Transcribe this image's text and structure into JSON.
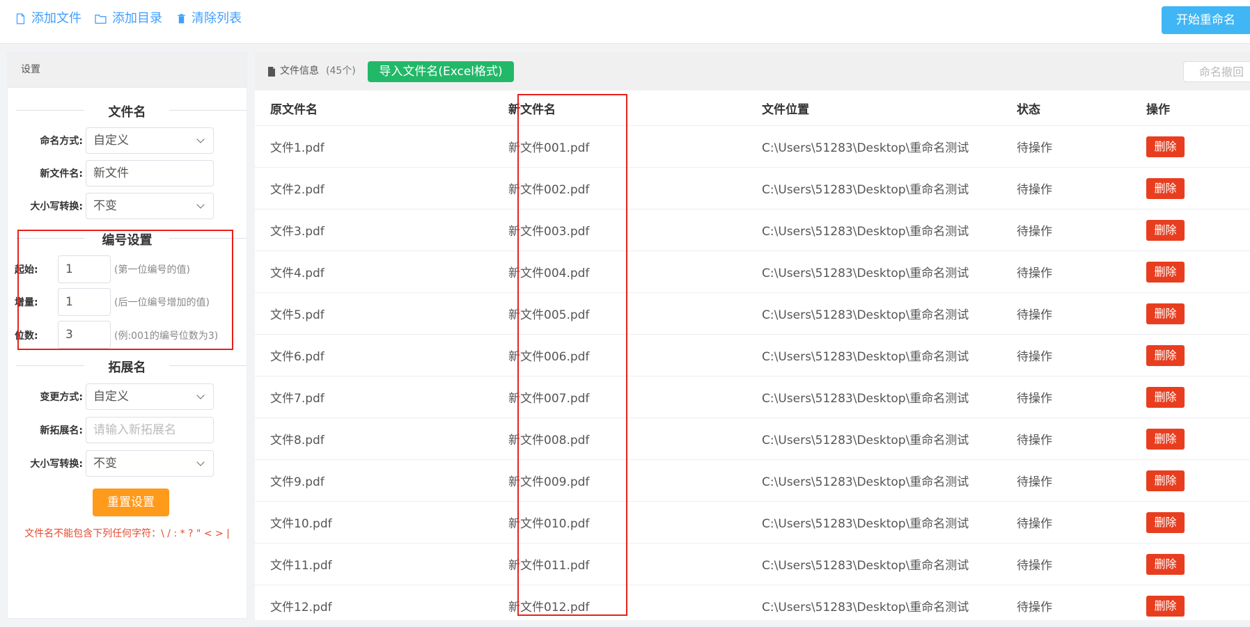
{
  "toolbar": {
    "add_file": "添加文件",
    "add_dir": "添加目录",
    "clear_list": "清除列表",
    "start_rename": "开始重命名"
  },
  "settings": {
    "header": "设置",
    "filename_section": "文件名",
    "naming_mode_label": "命名方式:",
    "naming_mode_value": "自定义",
    "new_name_label": "新文件名:",
    "new_name_value": "新文件",
    "case_label": "大小写转换:",
    "case_value": "不变",
    "numbering_section": "编号设置",
    "start_label": "起始:",
    "start_value": "1",
    "start_hint": "(第一位编号的值)",
    "step_label": "增量:",
    "step_value": "1",
    "step_hint": "(后一位编号增加的值)",
    "digits_label": "位数:",
    "digits_value": "3",
    "digits_hint": "(例:001的编号位数为3)",
    "ext_section": "拓展名",
    "ext_mode_label": "变更方式:",
    "ext_mode_value": "自定义",
    "new_ext_label": "新拓展名:",
    "new_ext_placeholder": "请输入新拓展名",
    "ext_case_label": "大小写转换:",
    "ext_case_value": "不变",
    "reset_button": "重置设置",
    "warning": "文件名不能包含下列任何字符：\\ / : * ? \" < > |"
  },
  "file_panel": {
    "info_label": "文件信息",
    "count": "(45个)",
    "import_button": "导入文件名(Excel格式)",
    "undo_button": "命名撤回",
    "columns": [
      "原文件名",
      "新文件名",
      "文件位置",
      "状态",
      "操作"
    ],
    "delete_label": "删除",
    "rows": [
      {
        "orig": "文件1.pdf",
        "new": "新文件001.pdf",
        "path": "C:\\Users\\51283\\Desktop\\重命名测试",
        "status": "待操作"
      },
      {
        "orig": "文件2.pdf",
        "new": "新文件002.pdf",
        "path": "C:\\Users\\51283\\Desktop\\重命名测试",
        "status": "待操作"
      },
      {
        "orig": "文件3.pdf",
        "new": "新文件003.pdf",
        "path": "C:\\Users\\51283\\Desktop\\重命名测试",
        "status": "待操作"
      },
      {
        "orig": "文件4.pdf",
        "new": "新文件004.pdf",
        "path": "C:\\Users\\51283\\Desktop\\重命名测试",
        "status": "待操作"
      },
      {
        "orig": "文件5.pdf",
        "new": "新文件005.pdf",
        "path": "C:\\Users\\51283\\Desktop\\重命名测试",
        "status": "待操作"
      },
      {
        "orig": "文件6.pdf",
        "new": "新文件006.pdf",
        "path": "C:\\Users\\51283\\Desktop\\重命名测试",
        "status": "待操作"
      },
      {
        "orig": "文件7.pdf",
        "new": "新文件007.pdf",
        "path": "C:\\Users\\51283\\Desktop\\重命名测试",
        "status": "待操作"
      },
      {
        "orig": "文件8.pdf",
        "new": "新文件008.pdf",
        "path": "C:\\Users\\51283\\Desktop\\重命名测试",
        "status": "待操作"
      },
      {
        "orig": "文件9.pdf",
        "new": "新文件009.pdf",
        "path": "C:\\Users\\51283\\Desktop\\重命名测试",
        "status": "待操作"
      },
      {
        "orig": "文件10.pdf",
        "new": "新文件010.pdf",
        "path": "C:\\Users\\51283\\Desktop\\重命名测试",
        "status": "待操作"
      },
      {
        "orig": "文件11.pdf",
        "new": "新文件011.pdf",
        "path": "C:\\Users\\51283\\Desktop\\重命名测试",
        "status": "待操作"
      },
      {
        "orig": "文件12.pdf",
        "new": "新文件012.pdf",
        "path": "C:\\Users\\51283\\Desktop\\重命名测试",
        "status": "待操作"
      }
    ]
  },
  "colors": {
    "link_blue": "#409eff",
    "primary_blue": "#40b6f5",
    "import_green": "#21b868",
    "reset_orange": "#ff9a1b",
    "delete_red": "#e83e1f",
    "highlight_red": "#e8201a"
  },
  "icons": {
    "add_file": "file-icon",
    "add_dir": "folder-icon",
    "clear_list": "trash-icon",
    "file_info": "document-icon"
  }
}
